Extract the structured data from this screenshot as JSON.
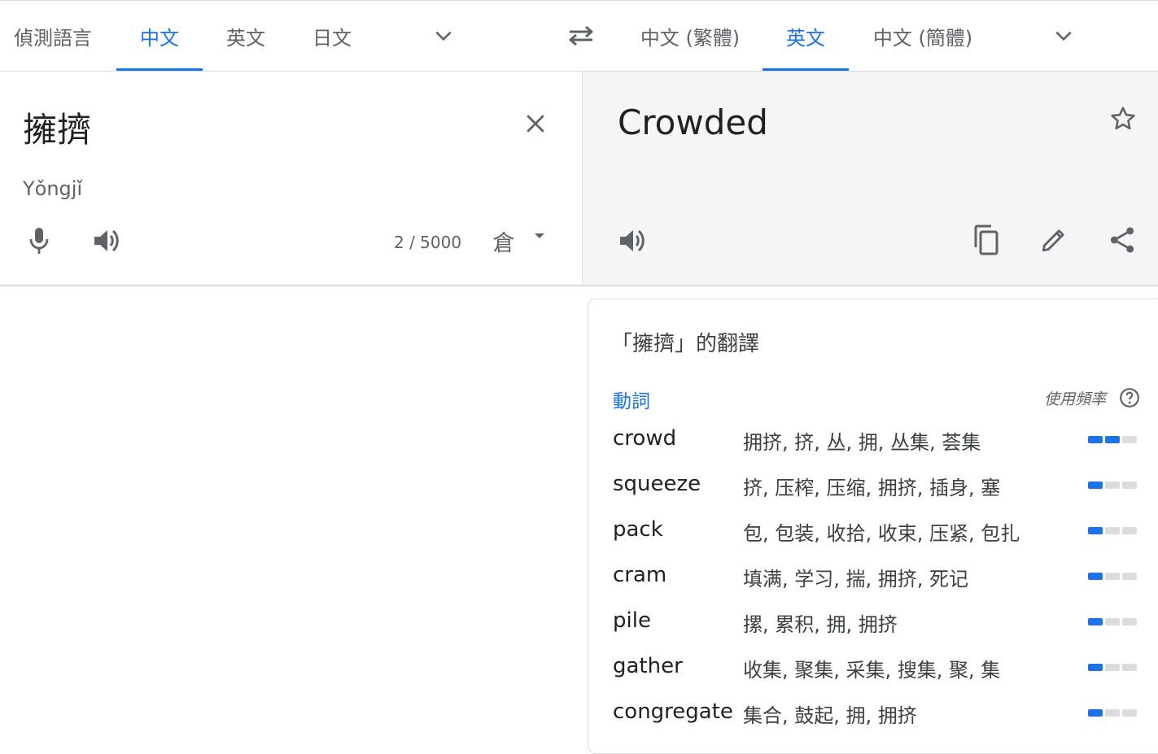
{
  "source_languages": {
    "tabs": [
      {
        "label": "偵測語言",
        "active": false
      },
      {
        "label": "中文",
        "active": true
      },
      {
        "label": "英文",
        "active": false
      },
      {
        "label": "日文",
        "active": false
      }
    ]
  },
  "target_languages": {
    "tabs": [
      {
        "label": "中文 (繁體)",
        "active": false
      },
      {
        "label": "英文",
        "active": true
      },
      {
        "label": "中文 (簡體)",
        "active": false
      }
    ]
  },
  "source": {
    "text": "擁擠",
    "romanization": "Yǒngjǐ",
    "char_count": "2 / 5000",
    "input_tool_glyph": "倉"
  },
  "target": {
    "text": "Crowded"
  },
  "dictionary": {
    "title": "「擁擠」的翻譯",
    "part_of_speech": "動詞",
    "frequency_label": "使用頻率",
    "entries": [
      {
        "word": "crowd",
        "synonyms": "拥挤, 挤, 丛, 拥, 丛集, 荟集",
        "frequency": 2
      },
      {
        "word": "squeeze",
        "synonyms": "挤, 压榨, 压缩, 拥挤, 插身, 塞",
        "frequency": 1
      },
      {
        "word": "pack",
        "synonyms": "包, 包装, 收拾, 收束, 压紧, 包扎",
        "frequency": 1
      },
      {
        "word": "cram",
        "synonyms": "填满, 学习, 揣, 拥挤, 死记",
        "frequency": 1
      },
      {
        "word": "pile",
        "synonyms": "摞, 累积, 拥, 拥挤",
        "frequency": 1
      },
      {
        "word": "gather",
        "synonyms": "收集, 聚集, 采集, 搜集, 聚, 集",
        "frequency": 1
      },
      {
        "word": "congregate",
        "synonyms": "集合, 鼓起, 拥, 拥挤",
        "frequency": 1
      }
    ]
  },
  "colors": {
    "accent": "#1a73e8",
    "icon": "#5f6368",
    "target_panel_bg": "#f5f5f5"
  }
}
